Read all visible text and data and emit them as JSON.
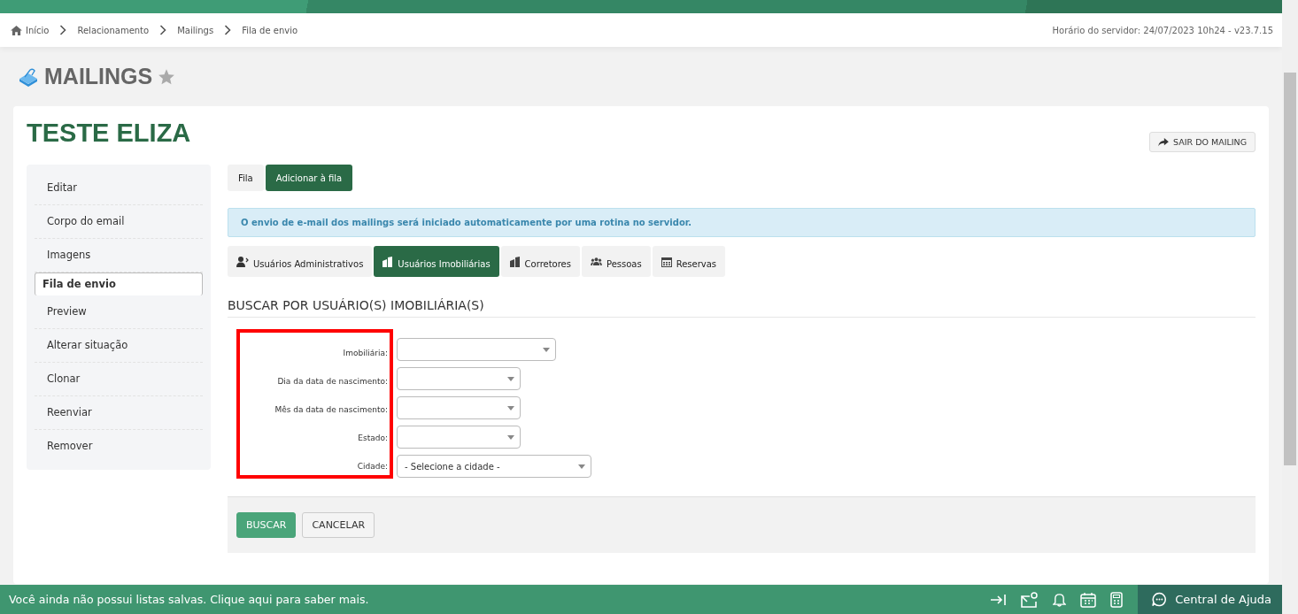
{
  "breadcrumb": [
    {
      "label": "Início",
      "kind": "home"
    },
    {
      "label": "Relacionamento",
      "kind": "link"
    },
    {
      "label": "Mailings",
      "kind": "link"
    },
    {
      "label": "Fila de envio",
      "kind": "current"
    }
  ],
  "server_time": "Horário do servidor: 24/07/2023 10h24 - v23.7.15",
  "page_title": "MAILINGS",
  "record_title": "TESTE ELIZA",
  "exit_button": "SAIR DO MAILING",
  "sidebar": {
    "items": [
      {
        "label": "Editar",
        "selected": false
      },
      {
        "label": "Corpo do email",
        "selected": false
      },
      {
        "label": "Imagens",
        "selected": false
      },
      {
        "label": "Fila de envio",
        "selected": true
      },
      {
        "label": "Preview",
        "selected": false
      },
      {
        "label": "Alterar situação",
        "selected": false
      },
      {
        "label": "Clonar",
        "selected": false
      },
      {
        "label": "Reenviar",
        "selected": false
      },
      {
        "label": "Remover",
        "selected": false
      }
    ]
  },
  "queue_tabs": [
    {
      "label": "Fila",
      "selected": false
    },
    {
      "label": "Adicionar à fila",
      "selected": true
    }
  ],
  "info_message": "O envio de e-mail dos mailings será iniciado automaticamente por uma rotina no servidor.",
  "user_tabs": [
    {
      "label": "Usuários Administrativos",
      "kind": "admin",
      "selected": false
    },
    {
      "label": "Usuários Imobiliárias",
      "kind": "building",
      "selected": true
    },
    {
      "label": "Corretores",
      "kind": "building",
      "selected": false
    },
    {
      "label": "Pessoas",
      "kind": "people",
      "selected": false
    },
    {
      "label": "Reservas",
      "kind": "calendar",
      "selected": false
    }
  ],
  "section_title": "BUSCAR POR USUÁRIO(S) IMOBILIÁRIA(S)",
  "form": {
    "highlighted": true,
    "fields": [
      {
        "label": "Imobiliária:"
      },
      {
        "label": "Dia da data de nascimento:"
      },
      {
        "label": "Mês da data de nascimento:"
      },
      {
        "label": "Estado:"
      },
      {
        "label": "Cidade:",
        "value": "- Selecione a cidade -"
      }
    ]
  },
  "actions": [
    {
      "label": "BUSCAR",
      "kind": "primary"
    },
    {
      "label": "CANCELAR",
      "kind": "secondary"
    }
  ],
  "footer": {
    "message": "Você ainda não possui listas salvas. Clique aqui para saber mais.",
    "help": "Central de Ajuda"
  }
}
